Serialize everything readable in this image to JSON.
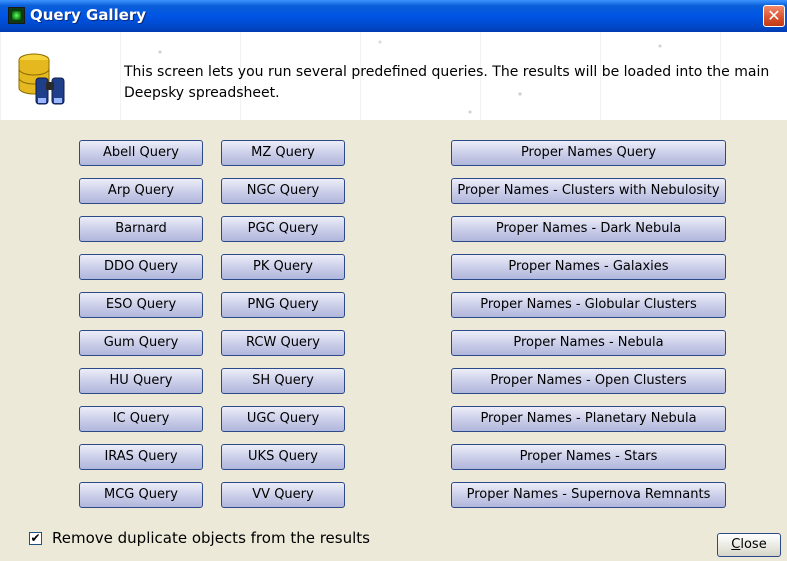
{
  "window": {
    "title": "Query Gallery",
    "close_glyph": "✕"
  },
  "banner": {
    "description": "This screen lets you run several predefined queries.  The results will be loaded into the main Deepsky spreadsheet.",
    "icon": "database-binoculars-icon"
  },
  "queries": {
    "col1": [
      "Abell Query",
      "Arp Query",
      "Barnard",
      "DDO Query",
      "ESO Query",
      "Gum Query",
      "HU Query",
      "IC Query",
      "IRAS Query",
      "MCG Query"
    ],
    "col2": [
      "MZ Query",
      "NGC Query",
      "PGC Query",
      "PK Query",
      "PNG Query",
      "RCW Query",
      "SH Query",
      "UGC Query",
      "UKS Query",
      "VV Query"
    ],
    "col3": [
      "Proper Names Query",
      "Proper Names - Clusters with Nebulosity",
      "Proper Names - Dark Nebula",
      "Proper Names - Galaxies",
      "Proper Names - Globular Clusters",
      "Proper Names - Nebula",
      "Proper Names - Open Clusters",
      "Proper Names - Planetary Nebula",
      "Proper Names - Stars",
      "Proper Names - Supernova Remnants"
    ]
  },
  "footer": {
    "remove_duplicates_label": "Remove duplicate objects from the results",
    "remove_duplicates_checked": true,
    "check_glyph": "✔",
    "close_label_first": "C",
    "close_label_rest": "lose"
  },
  "colors": {
    "titlebar": "#0055e5",
    "button_border": "#2c4a8a",
    "button_fill": "#c9cde8",
    "dialog_bg": "#ece9d8"
  }
}
